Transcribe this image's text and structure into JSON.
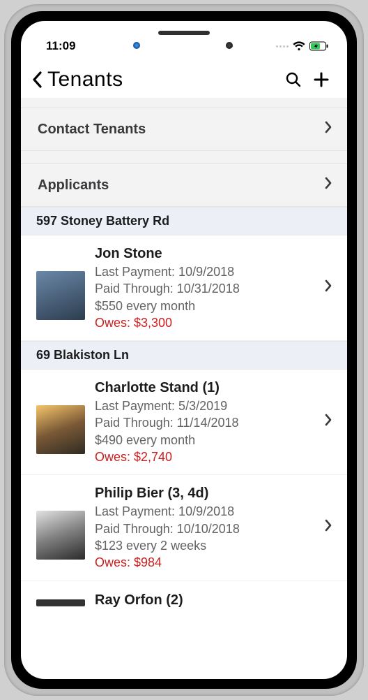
{
  "status": {
    "time": "11:09"
  },
  "nav": {
    "title": "Tenants",
    "search_icon": "search",
    "add_icon": "plus"
  },
  "sections": {
    "contact_tenants": "Contact Tenants",
    "applicants": "Applicants"
  },
  "groups": [
    {
      "address": "597 Stoney Battery Rd",
      "tenants": [
        {
          "name": "Jon Stone",
          "last_payment": "Last Payment: 10/9/2018",
          "paid_through": "Paid Through: 10/31/2018",
          "rent": "$550 every month",
          "owes": "Owes: $3,300"
        }
      ]
    },
    {
      "address": "69 Blakiston Ln",
      "tenants": [
        {
          "name": "Charlotte Stand (1)",
          "last_payment": "Last Payment: 5/3/2019",
          "paid_through": "Paid Through: 11/14/2018",
          "rent": "$490 every month",
          "owes": "Owes: $2,740"
        },
        {
          "name": "Philip Bier (3, 4d)",
          "last_payment": "Last Payment: 10/9/2018",
          "paid_through": "Paid Through: 10/10/2018",
          "rent": "$123 every 2 weeks",
          "owes": "Owes: $984"
        },
        {
          "name": "Ray Orfon (2)"
        }
      ]
    }
  ]
}
